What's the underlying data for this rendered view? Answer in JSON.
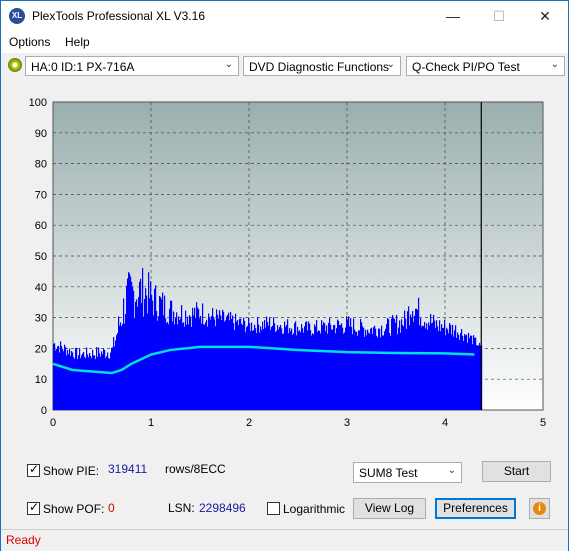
{
  "window": {
    "title": "PlexTools Professional XL V3.16",
    "app_icon_text": "XL",
    "minimize": "—",
    "maximize": "☐",
    "close": "✕"
  },
  "menu": [
    {
      "label": "Options"
    },
    {
      "label": "Help"
    }
  ],
  "toolbar": {
    "drive": "HA:0 ID:1  PX-716A",
    "function": "DVD Diagnostic Functions",
    "test": "Q-Check PI/PO Test",
    "arrow": "⌄"
  },
  "chart_data": {
    "type": "bar",
    "title": "",
    "xlabel": "",
    "ylabel": "",
    "x_ticks": [
      "0",
      "1",
      "2",
      "3",
      "4",
      "5"
    ],
    "y_ticks": [
      "0",
      "10",
      "20",
      "30",
      "40",
      "50",
      "60",
      "70",
      "80",
      "90",
      "100"
    ],
    "xlim": [
      0,
      5
    ],
    "ylim": [
      0,
      100
    ],
    "grid": true,
    "marker_x": 4.37,
    "colors": {
      "bars": "#0000ff",
      "line": "#00e0e0",
      "plot_bg_top": "#9aaeae",
      "plot_bg_bottom": "#ffffff"
    },
    "series": [
      {
        "kind": "bars",
        "x": [
          0.0,
          0.25,
          0.5,
          0.6,
          0.65,
          0.7,
          0.75,
          0.8,
          0.85,
          0.9,
          0.95,
          1.0,
          1.1,
          1.2,
          1.3,
          1.4,
          1.5,
          1.6,
          1.8,
          2.0,
          2.2,
          2.4,
          2.6,
          2.8,
          3.0,
          3.2,
          3.4,
          3.6,
          3.65,
          3.7,
          3.8,
          3.9,
          4.0,
          4.1,
          4.2,
          4.3,
          4.37
        ],
        "values": [
          24,
          20,
          21,
          22,
          30,
          38,
          45,
          46,
          47,
          47,
          46,
          43,
          40,
          37,
          36,
          35,
          36,
          34,
          32,
          30,
          31,
          30,
          29,
          30,
          31,
          29,
          30,
          33,
          41,
          38,
          34,
          31,
          30,
          29,
          27,
          24,
          21
        ]
      },
      {
        "kind": "line",
        "x": [
          0.0,
          0.2,
          0.4,
          0.6,
          0.7,
          0.8,
          1.0,
          1.2,
          1.5,
          2.0,
          2.5,
          3.0,
          3.5,
          4.0,
          4.3
        ],
        "values": [
          15,
          13,
          12.5,
          12,
          13,
          15,
          18,
          19.5,
          20.5,
          20.5,
          19.5,
          18.8,
          18.5,
          18.4,
          18
        ]
      }
    ]
  },
  "bottom": {
    "show_pie_label": "Show PIE:",
    "show_pie_value": "319411",
    "pie_unit": "rows/8ECC",
    "show_pof_label": "Show POF:",
    "show_pof_value": "0",
    "lsn_label": "LSN:",
    "lsn_value": "2298496",
    "log_label": "Logarithmic",
    "sum8": "SUM8 Test",
    "start": "Start",
    "view_log": "View Log",
    "preferences": "Preferences",
    "info": "i",
    "check": "✓"
  },
  "status": "Ready"
}
